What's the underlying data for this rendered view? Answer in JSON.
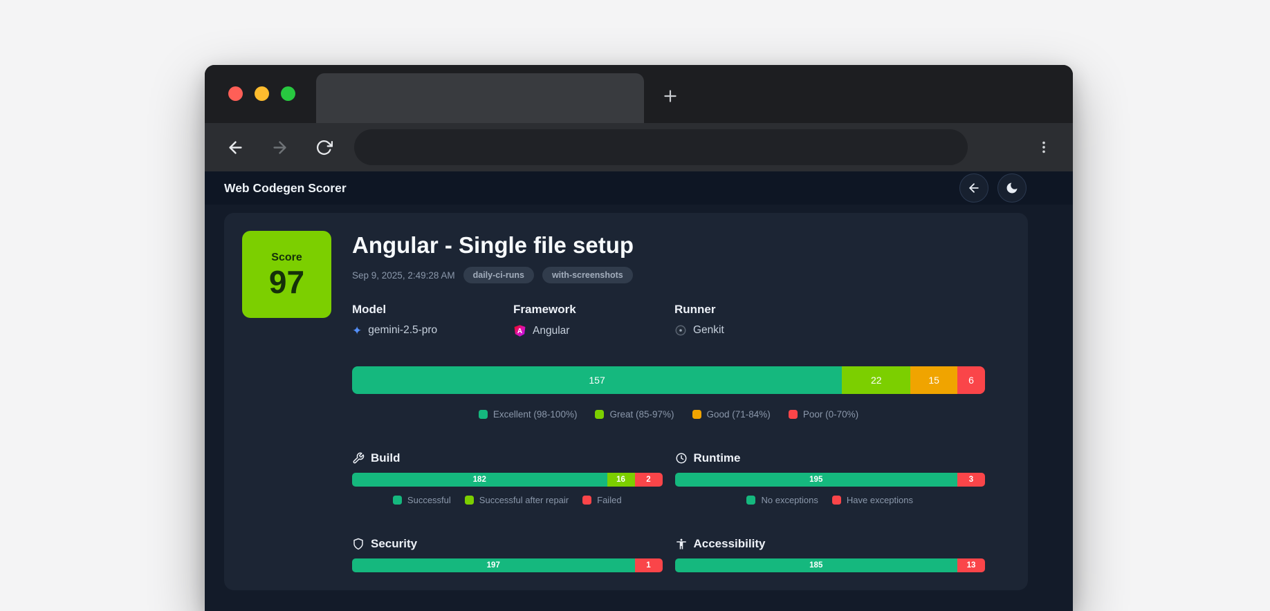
{
  "header": {
    "title": "Web Codegen Scorer"
  },
  "report": {
    "score_label": "Score",
    "score_value": "97",
    "title": "Angular - Single file setup",
    "date": "Sep 9, 2025, 2:49:28 AM",
    "tags": [
      "daily-ci-runs",
      "with-screenshots"
    ],
    "meta": [
      {
        "label": "Model",
        "value": "gemini-2.5-pro"
      },
      {
        "label": "Framework",
        "value": "Angular"
      },
      {
        "label": "Runner",
        "value": "Genkit"
      }
    ],
    "overall_bar": {
      "segments": [
        {
          "value": 157,
          "color": "excellent"
        },
        {
          "value": 22,
          "color": "great"
        },
        {
          "value": 15,
          "color": "good"
        },
        {
          "value": 6,
          "color": "poor"
        }
      ]
    },
    "overall_legend": [
      {
        "label": "Excellent (98-100%)",
        "color": "excellent"
      },
      {
        "label": "Great (85-97%)",
        "color": "great"
      },
      {
        "label": "Good (71-84%)",
        "color": "good"
      },
      {
        "label": "Poor (0-70%)",
        "color": "poor"
      }
    ],
    "sections": [
      {
        "name": "Build",
        "segments": [
          {
            "value": 182,
            "color": "excellent"
          },
          {
            "value": 16,
            "color": "great"
          },
          {
            "value": 2,
            "color": "poor"
          }
        ],
        "legend": [
          {
            "label": "Successful",
            "color": "excellent"
          },
          {
            "label": "Successful after repair",
            "color": "great"
          },
          {
            "label": "Failed",
            "color": "poor"
          }
        ]
      },
      {
        "name": "Runtime",
        "segments": [
          {
            "value": 195,
            "color": "excellent"
          },
          {
            "value": 3,
            "color": "poor"
          }
        ],
        "legend": [
          {
            "label": "No exceptions",
            "color": "excellent"
          },
          {
            "label": "Have exceptions",
            "color": "poor"
          }
        ]
      },
      {
        "name": "Security",
        "segments": [
          {
            "value": 197,
            "color": "excellent"
          },
          {
            "value": 1,
            "color": "poor"
          }
        ],
        "legend": []
      },
      {
        "name": "Accessibility",
        "segments": [
          {
            "value": 185,
            "color": "excellent"
          },
          {
            "value": 13,
            "color": "poor"
          }
        ],
        "legend": []
      }
    ]
  },
  "colors": {
    "excellent": "#15b87e",
    "great": "#7ccf00",
    "good": "#f0a400",
    "poor": "#fa4549",
    "score_badge": "#7ccf00"
  }
}
